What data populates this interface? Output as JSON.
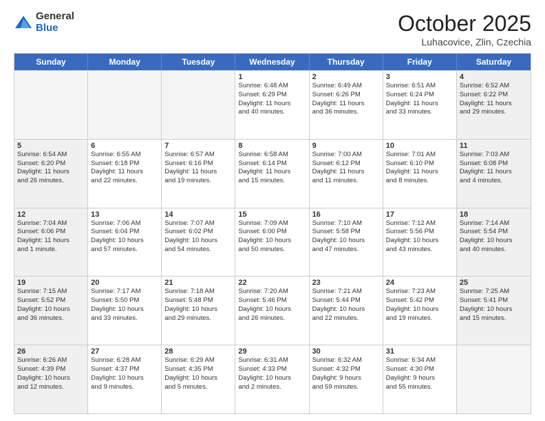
{
  "header": {
    "logo_general": "General",
    "logo_blue": "Blue",
    "month_title": "October 2025",
    "location": "Luhacovice, Zlin, Czechia"
  },
  "days_of_week": [
    "Sunday",
    "Monday",
    "Tuesday",
    "Wednesday",
    "Thursday",
    "Friday",
    "Saturday"
  ],
  "weeks": [
    [
      {
        "day": "",
        "empty": true
      },
      {
        "day": "",
        "empty": true
      },
      {
        "day": "",
        "empty": true
      },
      {
        "day": "1",
        "l1": "Sunrise: 6:48 AM",
        "l2": "Sunset: 6:29 PM",
        "l3": "Daylight: 11 hours",
        "l4": "and 40 minutes."
      },
      {
        "day": "2",
        "l1": "Sunrise: 6:49 AM",
        "l2": "Sunset: 6:26 PM",
        "l3": "Daylight: 11 hours",
        "l4": "and 36 minutes."
      },
      {
        "day": "3",
        "l1": "Sunrise: 6:51 AM",
        "l2": "Sunset: 6:24 PM",
        "l3": "Daylight: 11 hours",
        "l4": "and 33 minutes."
      },
      {
        "day": "4",
        "l1": "Sunrise: 6:52 AM",
        "l2": "Sunset: 6:22 PM",
        "l3": "Daylight: 11 hours",
        "l4": "and 29 minutes.",
        "shaded": true
      }
    ],
    [
      {
        "day": "5",
        "l1": "Sunrise: 6:54 AM",
        "l2": "Sunset: 6:20 PM",
        "l3": "Daylight: 11 hours",
        "l4": "and 26 minutes.",
        "shaded": true
      },
      {
        "day": "6",
        "l1": "Sunrise: 6:55 AM",
        "l2": "Sunset: 6:18 PM",
        "l3": "Daylight: 11 hours",
        "l4": "and 22 minutes."
      },
      {
        "day": "7",
        "l1": "Sunrise: 6:57 AM",
        "l2": "Sunset: 6:16 PM",
        "l3": "Daylight: 11 hours",
        "l4": "and 19 minutes."
      },
      {
        "day": "8",
        "l1": "Sunrise: 6:58 AM",
        "l2": "Sunset: 6:14 PM",
        "l3": "Daylight: 11 hours",
        "l4": "and 15 minutes."
      },
      {
        "day": "9",
        "l1": "Sunrise: 7:00 AM",
        "l2": "Sunset: 6:12 PM",
        "l3": "Daylight: 11 hours",
        "l4": "and 11 minutes."
      },
      {
        "day": "10",
        "l1": "Sunrise: 7:01 AM",
        "l2": "Sunset: 6:10 PM",
        "l3": "Daylight: 11 hours",
        "l4": "and 8 minutes."
      },
      {
        "day": "11",
        "l1": "Sunrise: 7:03 AM",
        "l2": "Sunset: 6:08 PM",
        "l3": "Daylight: 11 hours",
        "l4": "and 4 minutes.",
        "shaded": true
      }
    ],
    [
      {
        "day": "12",
        "l1": "Sunrise: 7:04 AM",
        "l2": "Sunset: 6:06 PM",
        "l3": "Daylight: 11 hours",
        "l4": "and 1 minute.",
        "shaded": true
      },
      {
        "day": "13",
        "l1": "Sunrise: 7:06 AM",
        "l2": "Sunset: 6:04 PM",
        "l3": "Daylight: 10 hours",
        "l4": "and 57 minutes."
      },
      {
        "day": "14",
        "l1": "Sunrise: 7:07 AM",
        "l2": "Sunset: 6:02 PM",
        "l3": "Daylight: 10 hours",
        "l4": "and 54 minutes."
      },
      {
        "day": "15",
        "l1": "Sunrise: 7:09 AM",
        "l2": "Sunset: 6:00 PM",
        "l3": "Daylight: 10 hours",
        "l4": "and 50 minutes."
      },
      {
        "day": "16",
        "l1": "Sunrise: 7:10 AM",
        "l2": "Sunset: 5:58 PM",
        "l3": "Daylight: 10 hours",
        "l4": "and 47 minutes."
      },
      {
        "day": "17",
        "l1": "Sunrise: 7:12 AM",
        "l2": "Sunset: 5:56 PM",
        "l3": "Daylight: 10 hours",
        "l4": "and 43 minutes."
      },
      {
        "day": "18",
        "l1": "Sunrise: 7:14 AM",
        "l2": "Sunset: 5:54 PM",
        "l3": "Daylight: 10 hours",
        "l4": "and 40 minutes.",
        "shaded": true
      }
    ],
    [
      {
        "day": "19",
        "l1": "Sunrise: 7:15 AM",
        "l2": "Sunset: 5:52 PM",
        "l3": "Daylight: 10 hours",
        "l4": "and 36 minutes.",
        "shaded": true
      },
      {
        "day": "20",
        "l1": "Sunrise: 7:17 AM",
        "l2": "Sunset: 5:50 PM",
        "l3": "Daylight: 10 hours",
        "l4": "and 33 minutes."
      },
      {
        "day": "21",
        "l1": "Sunrise: 7:18 AM",
        "l2": "Sunset: 5:48 PM",
        "l3": "Daylight: 10 hours",
        "l4": "and 29 minutes."
      },
      {
        "day": "22",
        "l1": "Sunrise: 7:20 AM",
        "l2": "Sunset: 5:46 PM",
        "l3": "Daylight: 10 hours",
        "l4": "and 26 minutes."
      },
      {
        "day": "23",
        "l1": "Sunrise: 7:21 AM",
        "l2": "Sunset: 5:44 PM",
        "l3": "Daylight: 10 hours",
        "l4": "and 22 minutes."
      },
      {
        "day": "24",
        "l1": "Sunrise: 7:23 AM",
        "l2": "Sunset: 5:42 PM",
        "l3": "Daylight: 10 hours",
        "l4": "and 19 minutes."
      },
      {
        "day": "25",
        "l1": "Sunrise: 7:25 AM",
        "l2": "Sunset: 5:41 PM",
        "l3": "Daylight: 10 hours",
        "l4": "and 15 minutes.",
        "shaded": true
      }
    ],
    [
      {
        "day": "26",
        "l1": "Sunrise: 6:26 AM",
        "l2": "Sunset: 4:39 PM",
        "l3": "Daylight: 10 hours",
        "l4": "and 12 minutes.",
        "shaded": true
      },
      {
        "day": "27",
        "l1": "Sunrise: 6:28 AM",
        "l2": "Sunset: 4:37 PM",
        "l3": "Daylight: 10 hours",
        "l4": "and 9 minutes."
      },
      {
        "day": "28",
        "l1": "Sunrise: 6:29 AM",
        "l2": "Sunset: 4:35 PM",
        "l3": "Daylight: 10 hours",
        "l4": "and 5 minutes."
      },
      {
        "day": "29",
        "l1": "Sunrise: 6:31 AM",
        "l2": "Sunset: 4:33 PM",
        "l3": "Daylight: 10 hours",
        "l4": "and 2 minutes."
      },
      {
        "day": "30",
        "l1": "Sunrise: 6:32 AM",
        "l2": "Sunset: 4:32 PM",
        "l3": "Daylight: 9 hours",
        "l4": "and 59 minutes."
      },
      {
        "day": "31",
        "l1": "Sunrise: 6:34 AM",
        "l2": "Sunset: 4:30 PM",
        "l3": "Daylight: 9 hours",
        "l4": "and 55 minutes."
      },
      {
        "day": "",
        "empty": true,
        "shaded": true
      }
    ]
  ]
}
